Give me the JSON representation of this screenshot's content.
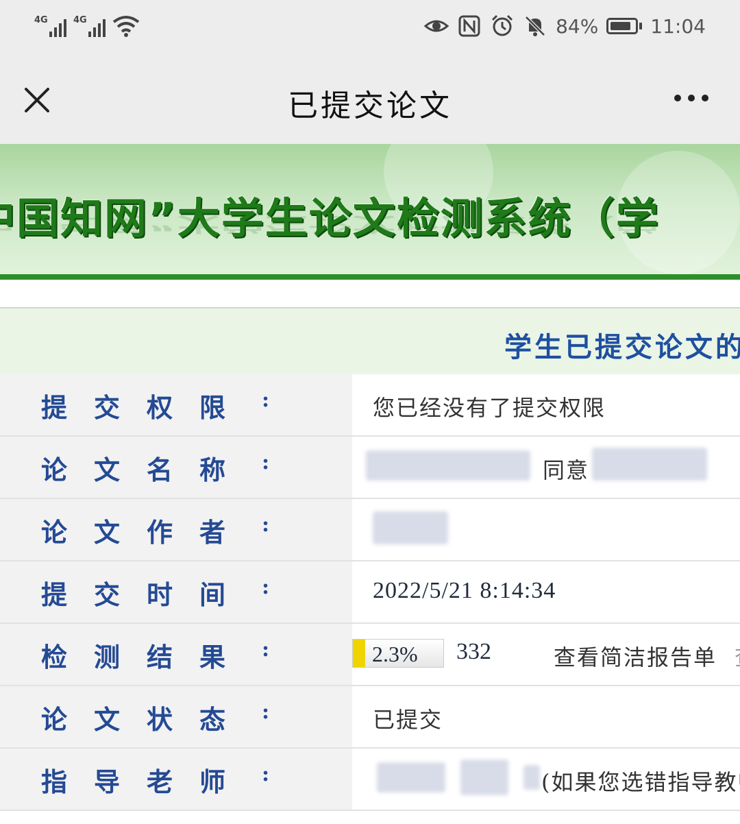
{
  "status_bar": {
    "signal_1": "4G",
    "signal_2": "4G",
    "battery": "84%",
    "time": "11:04",
    "icons": [
      "eye-icon",
      "nfc-icon",
      "alarm-icon",
      "mute-bell-icon"
    ]
  },
  "nav": {
    "title": "已提交论文"
  },
  "banner": {
    "title": "中国知网”大学生论文检测系统（学"
  },
  "table": {
    "header": "学生已提交论文的",
    "rows": [
      {
        "label": [
          "提",
          "交",
          "权",
          "限"
        ],
        "value": "您已经没有了提交权限"
      },
      {
        "label": [
          "论",
          "文",
          "名",
          "称"
        ],
        "value": "同意"
      },
      {
        "label": [
          "论",
          "文",
          "作",
          "者"
        ],
        "value": ""
      },
      {
        "label": [
          "提",
          "交",
          "时",
          "间"
        ],
        "value": "2022/5/21 8:14:34"
      },
      {
        "label": [
          "检",
          "测",
          "结",
          "果"
        ],
        "value": ""
      },
      {
        "label": [
          "论",
          "文",
          "状",
          "态"
        ],
        "value": "已提交"
      },
      {
        "label": [
          "指",
          "导",
          "老",
          "师"
        ],
        "value": "(如果您选错指导教师"
      }
    ],
    "colon": ":",
    "result": {
      "similarity": "2.3%",
      "similarity_fraction": 0.023,
      "word_count": "332",
      "report_link": "查看简洁报告单",
      "extra": "查"
    }
  },
  "colors": {
    "label_blue": "#244a94",
    "header_blue": "#1e4fa0",
    "banner_green": "#1f7a19",
    "progress_yellow": "#f0d400"
  }
}
